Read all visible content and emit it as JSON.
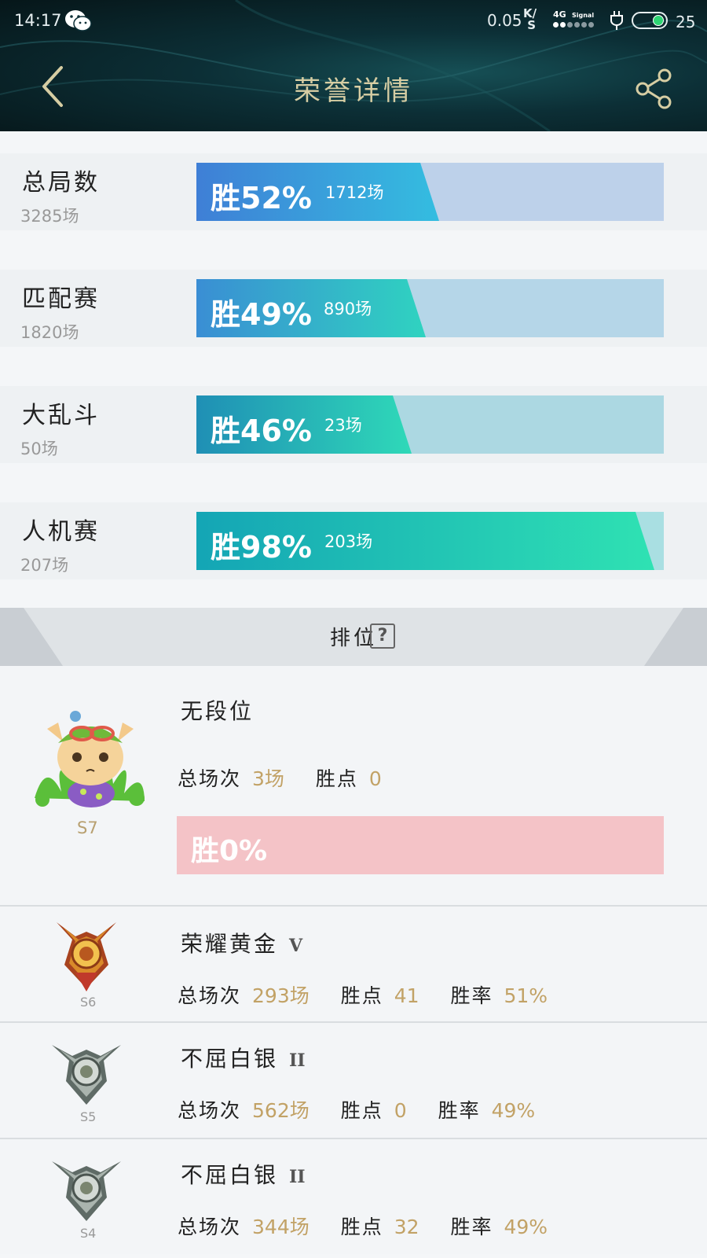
{
  "status_bar": {
    "time": "14:17",
    "net_speed": "0.05",
    "speed_unit_top": "K",
    "speed_unit_bottom": "S",
    "net_type": "4G",
    "signal_label": "Signal",
    "battery": "25"
  },
  "header": {
    "title": "荣誉详情",
    "back_icon": "chevron-left-icon",
    "share_icon": "share-icon"
  },
  "stats": [
    {
      "label": "总局数",
      "count": "3285场",
      "win_pct": "胜52%",
      "win_fraction": 0.52,
      "wins": "1712场",
      "gradient": [
        "#3f7fd6",
        "#34bde0"
      ],
      "track_color": "#bdd1ea"
    },
    {
      "label": "匹配赛",
      "count": "1820场",
      "win_pct": "胜49%",
      "win_fraction": 0.49,
      "wins": "890场",
      "gradient": [
        "#3a8ed4",
        "#2fd3c0"
      ],
      "track_color": "#b5d6e8"
    },
    {
      "label": "大乱斗",
      "count": "50场",
      "win_pct": "胜46%",
      "win_fraction": 0.46,
      "wins": "23场",
      "gradient": [
        "#1f8fb5",
        "#2fd9b8"
      ],
      "track_color": "#acd8e2"
    },
    {
      "label": "人机赛",
      "count": "207场",
      "win_pct": "胜98%",
      "win_fraction": 0.98,
      "wins": "203场",
      "gradient": [
        "#14a5b5",
        "#2fe2b3"
      ],
      "track_color": "#a9dfe2"
    }
  ],
  "ranked": {
    "title": "排位",
    "help_icon": "?",
    "current": {
      "season": "S7",
      "rank": "无段位",
      "total_label": "总场次",
      "total": "3场",
      "points_label": "胜点",
      "points": "0",
      "win_pct": "胜0%",
      "win_fraction": 0,
      "bar_color": "#f4c3c7"
    },
    "history": [
      {
        "season": "S6",
        "rank": "荣耀黄金",
        "tier": "V",
        "total_label": "总场次",
        "total": "293场",
        "points_label": "胜点",
        "points": "41",
        "rate_label": "胜率",
        "rate": "51%",
        "emblem": "gold-rank-emblem-icon"
      },
      {
        "season": "S5",
        "rank": "不屈白银",
        "tier": "II",
        "total_label": "总场次",
        "total": "562场",
        "points_label": "胜点",
        "points": "0",
        "rate_label": "胜率",
        "rate": "49%",
        "emblem": "silver-rank-emblem-icon"
      },
      {
        "season": "S4",
        "rank": "不屈白银",
        "tier": "II",
        "total_label": "总场次",
        "total": "344场",
        "points_label": "胜点",
        "points": "32",
        "rate_label": "胜率",
        "rate": "49%",
        "emblem": "silver-rank-emblem-icon"
      }
    ]
  }
}
